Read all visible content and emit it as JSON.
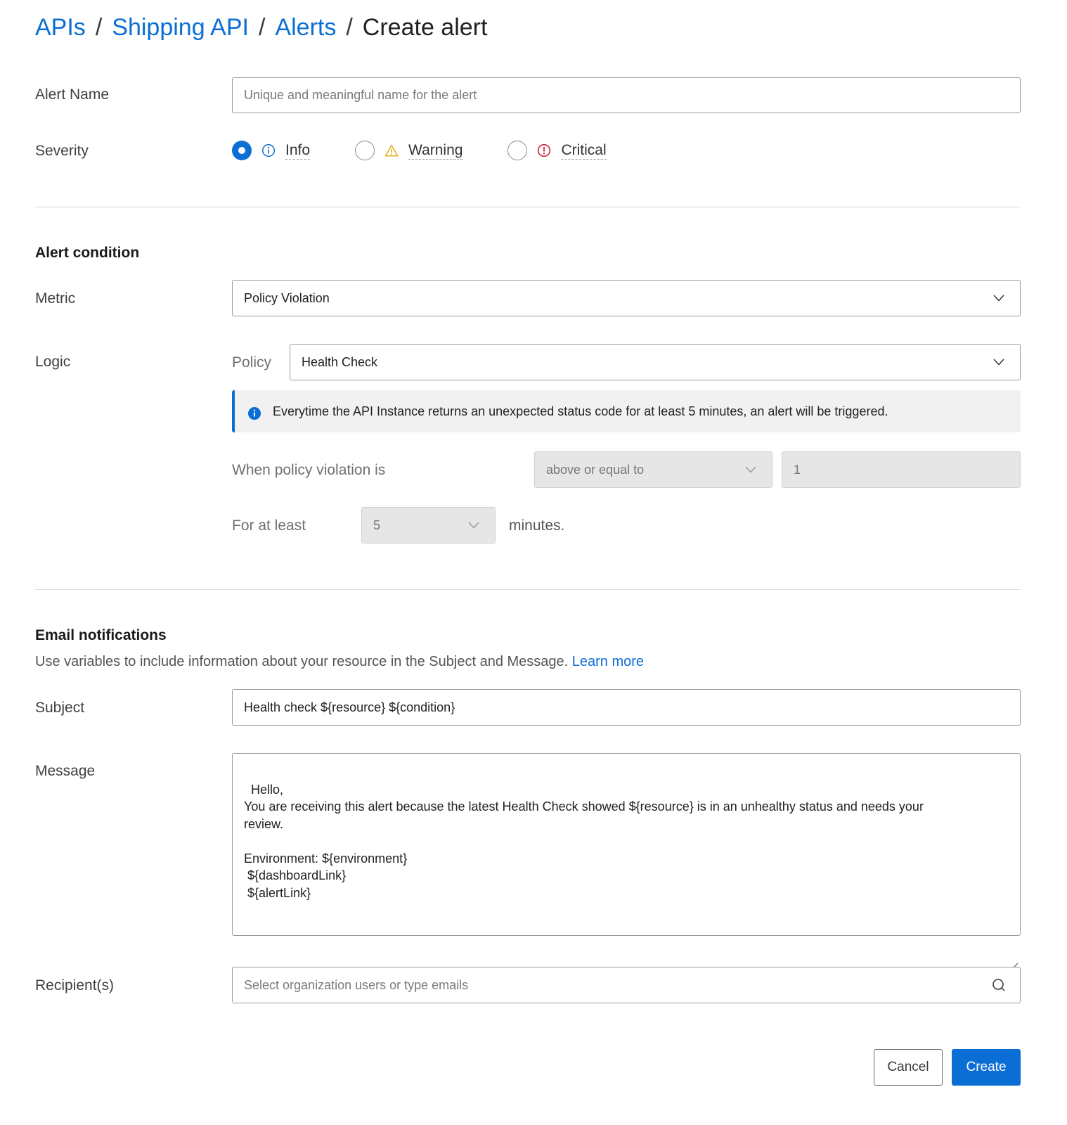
{
  "breadcrumb": {
    "items": [
      "APIs",
      "Shipping API",
      "Alerts"
    ],
    "separator": "/",
    "current": "Create alert"
  },
  "alert_name": {
    "label": "Alert Name",
    "value": "",
    "placeholder": "Unique and meaningful name for the alert"
  },
  "severity": {
    "label": "Severity",
    "selected": "Info",
    "options": [
      {
        "label": "Info",
        "icon": "info-icon",
        "color": "#0b6ed5"
      },
      {
        "label": "Warning",
        "icon": "warning-icon",
        "color": "#e6a700"
      },
      {
        "label": "Critical",
        "icon": "critical-icon",
        "color": "#c8102e"
      }
    ]
  },
  "alert_condition": {
    "title": "Alert condition",
    "metric_label": "Metric",
    "metric_value": "Policy Violation",
    "logic_label": "Logic",
    "policy_label": "Policy",
    "policy_value": "Health Check",
    "info_text": "Everytime the API Instance returns an unexpected status code for at least 5 minutes, an alert will be triggered.",
    "when_label": "When policy violation is",
    "operator_value": "above or equal to",
    "threshold_value": "1",
    "for_label": "For at least",
    "minutes_value": "5",
    "minutes_suffix": "minutes."
  },
  "email": {
    "title": "Email notifications",
    "help_text": "Use variables to include information about your resource in the Subject and Message.",
    "learn_more": "Learn more",
    "subject_label": "Subject",
    "subject_value": "Health check ${resource} ${condition}",
    "message_label": "Message",
    "message_value": "Hello,\nYou are receiving this alert because the latest Health Check showed ${resource} is in an unhealthy status and needs your\nreview.\n\nEnvironment: ${environment}\n ${dashboardLink}\n ${alertLink}",
    "recipients_label": "Recipient(s)",
    "recipients_placeholder": "Select organization users or type emails"
  },
  "actions": {
    "cancel": "Cancel",
    "create": "Create"
  },
  "colors": {
    "accent": "#0b6ed5",
    "warning": "#e6a700",
    "critical": "#c8102e"
  }
}
